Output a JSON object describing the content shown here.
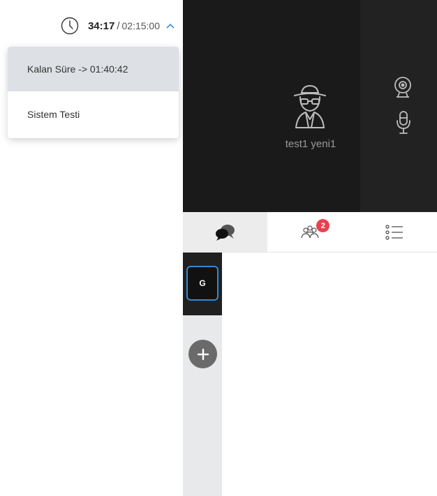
{
  "timer": {
    "elapsed": "34:17",
    "separator": "/",
    "total": "02:15:00"
  },
  "dropdown": {
    "items": [
      {
        "label": "Kalan Süre -> 01:40:42",
        "active": true
      },
      {
        "label": "Sistem Testi",
        "active": false
      }
    ]
  },
  "video": {
    "participant_name": "test1 yeni1"
  },
  "tabs": {
    "participants_badge": "2"
  },
  "chat": {
    "group_label": "G"
  },
  "colors": {
    "video_bg": "#1a1a1a",
    "accent_blue": "#2f8ad8",
    "badge_red": "#e8424f"
  }
}
